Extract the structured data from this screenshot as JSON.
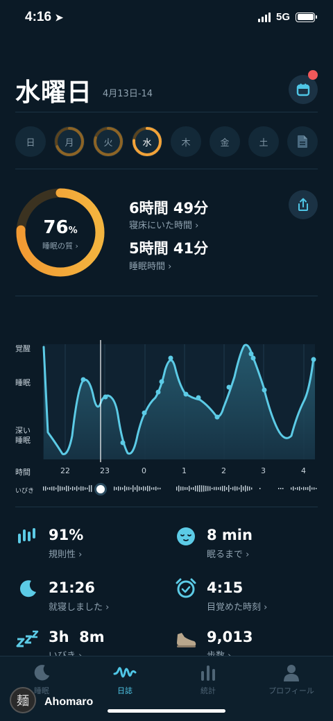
{
  "status_bar": {
    "time": "4:16",
    "network": "5G"
  },
  "header": {
    "day": "水曜日",
    "date_range": "4月13日-14"
  },
  "week": [
    "日",
    "月",
    "火",
    "水",
    "木",
    "金",
    "土"
  ],
  "summary": {
    "quality_percent": "76",
    "percent_sign": "%",
    "quality_label": "睡眠の質 ›",
    "quality_value": 0.76,
    "in_bed_time": "6時間 49分",
    "in_bed_label": "寝床にいた時間 ›",
    "sleep_time": "5時間 41分",
    "sleep_label": "睡眠時間 ›"
  },
  "chart": {
    "y_labels": {
      "awake": "覚醒",
      "sleep": "睡眠",
      "deep1": "深い",
      "deep2": "睡眠"
    },
    "x_title": "時間",
    "x_ticks": [
      "22",
      "23",
      "0",
      "1",
      "2",
      "3",
      "4"
    ],
    "snore_label": "いびき"
  },
  "metrics": [
    {
      "value": "91%",
      "label": "規則性 ›",
      "icon": "bars-icon"
    },
    {
      "value": "8 min",
      "label": "眠るまで ›",
      "icon": "sleepy-face-icon"
    },
    {
      "value": "21:26",
      "label": "就寝しました ›",
      "icon": "moon-icon"
    },
    {
      "value": "4:15",
      "label": "目覚めた時刻 ›",
      "icon": "alarm-clock-icon"
    },
    {
      "value": "3h  8m",
      "label": "いびき ›",
      "icon": "zzz-icon"
    },
    {
      "value": "9,013",
      "label": "歩数 ›",
      "icon": "shoe-icon"
    }
  ],
  "tabs": [
    {
      "label": "睡眠",
      "icon": "moon-icon"
    },
    {
      "label": "日誌",
      "icon": "wave-icon",
      "active": true
    },
    {
      "label": "統計",
      "icon": "bar-chart-icon"
    },
    {
      "label": "プロフィール",
      "icon": "person-icon"
    }
  ],
  "watermark": {
    "name": "Ahomaro",
    "avatar_char": "麺"
  },
  "colors": {
    "accent": "#4fc6e6",
    "ring_orange": "#f2a33a",
    "background": "#0b1a26"
  }
}
